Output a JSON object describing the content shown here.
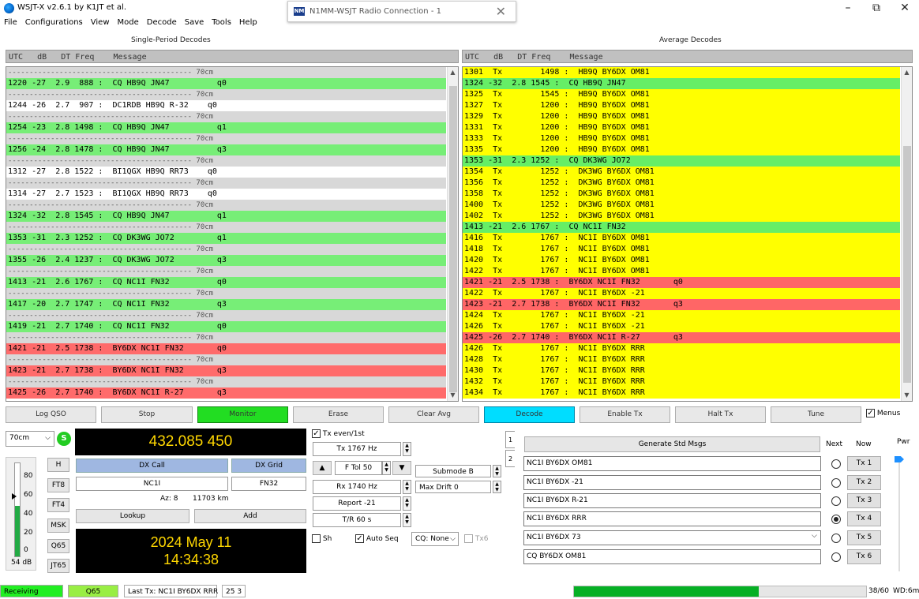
{
  "window": {
    "title": "WSJT-X  v2.6.1  by K1JT et al.",
    "min": "–",
    "max": "⧉",
    "close": "✕"
  },
  "popup": {
    "icon": "NM",
    "title": "N1MM-WSJT Radio Connection - 1",
    "close": "✕"
  },
  "menu": [
    "File",
    "Configurations",
    "View",
    "Mode",
    "Decode",
    "Save",
    "Tools",
    "Help"
  ],
  "left": {
    "title": "Single-Period Decodes",
    "header": "UTC   dB   DT Freq    Message",
    "lines": [
      {
        "c": "sep",
        "t": "------------------------------------------- 70cm"
      },
      {
        "c": "g",
        "t": "1220 -27  2.9  888 :  CQ HB9Q JN47          q0"
      },
      {
        "c": "sep",
        "t": "------------------------------------------- 70cm"
      },
      {
        "c": "w",
        "t": "1244 -26  2.7  907 :  DC1RDB HB9Q R-32    q0"
      },
      {
        "c": "sep",
        "t": "------------------------------------------- 70cm"
      },
      {
        "c": "g",
        "t": "1254 -23  2.8 1498 :  CQ HB9Q JN47          q1"
      },
      {
        "c": "sep",
        "t": "------------------------------------------- 70cm"
      },
      {
        "c": "g",
        "t": "1256 -24  2.8 1478 :  CQ HB9Q JN47          q3"
      },
      {
        "c": "sep",
        "t": "------------------------------------------- 70cm"
      },
      {
        "c": "w",
        "t": "1312 -27  2.8 1522 :  BI1QGX HB9Q RR73    q0"
      },
      {
        "c": "sep",
        "t": "------------------------------------------- 70cm"
      },
      {
        "c": "w",
        "t": "1314 -27  2.7 1523 :  BI1QGX HB9Q RR73    q0"
      },
      {
        "c": "sep",
        "t": "------------------------------------------- 70cm"
      },
      {
        "c": "g",
        "t": "1324 -32  2.8 1545 :  CQ HB9Q JN47          q1"
      },
      {
        "c": "sep",
        "t": "------------------------------------------- 70cm"
      },
      {
        "c": "g",
        "t": "1353 -31  2.3 1252 :  CQ DK3WG JO72         q1"
      },
      {
        "c": "sep",
        "t": "------------------------------------------- 70cm"
      },
      {
        "c": "g",
        "t": "1355 -26  2.4 1237 :  CQ DK3WG JO72         q3"
      },
      {
        "c": "sep",
        "t": "------------------------------------------- 70cm"
      },
      {
        "c": "g",
        "t": "1413 -21  2.6 1767 :  CQ NC1I FN32          q0"
      },
      {
        "c": "sep",
        "t": "------------------------------------------- 70cm"
      },
      {
        "c": "g",
        "t": "1417 -20  2.7 1747 :  CQ NC1I FN32          q3"
      },
      {
        "c": "sep",
        "t": "------------------------------------------- 70cm"
      },
      {
        "c": "g",
        "t": "1419 -21  2.7 1740 :  CQ NC1I FN32          q0"
      },
      {
        "c": "sep",
        "t": "------------------------------------------- 70cm"
      },
      {
        "c": "r",
        "t": "1421 -21  2.5 1738 :  BY6DX NC1I FN32       q0"
      },
      {
        "c": "sep",
        "t": "------------------------------------------- 70cm"
      },
      {
        "c": "r",
        "t": "1423 -21  2.7 1738 :  BY6DX NC1I FN32       q3"
      },
      {
        "c": "sep",
        "t": "------------------------------------------- 70cm"
      },
      {
        "c": "r",
        "t": "1425 -26  2.7 1740 :  BY6DX NC1I R-27       q3"
      }
    ]
  },
  "right": {
    "title": "Average Decodes",
    "header": "UTC   dB   DT Freq    Message",
    "lines": [
      {
        "c": "y",
        "t": "1301  Tx        1498 :  HB9Q BY6DX OM81"
      },
      {
        "c": "yg",
        "t": "1324 -32  2.8 1545 :  CQ HB9Q JN47"
      },
      {
        "c": "y",
        "t": "1325  Tx        1545 :  HB9Q BY6DX OM81"
      },
      {
        "c": "y",
        "t": "1327  Tx        1200 :  HB9Q BY6DX OM81"
      },
      {
        "c": "y",
        "t": "1329  Tx        1200 :  HB9Q BY6DX OM81"
      },
      {
        "c": "y",
        "t": "1331  Tx        1200 :  HB9Q BY6DX OM81"
      },
      {
        "c": "y",
        "t": "1333  Tx        1200 :  HB9Q BY6DX OM81"
      },
      {
        "c": "y",
        "t": "1335  Tx        1200 :  HB9Q BY6DX OM81"
      },
      {
        "c": "yg",
        "t": "1353 -31  2.3 1252 :  CQ DK3WG JO72"
      },
      {
        "c": "y",
        "t": "1354  Tx        1252 :  DK3WG BY6DX OM81"
      },
      {
        "c": "y",
        "t": "1356  Tx        1252 :  DK3WG BY6DX OM81"
      },
      {
        "c": "y",
        "t": "1358  Tx        1252 :  DK3WG BY6DX OM81"
      },
      {
        "c": "y",
        "t": "1400  Tx        1252 :  DK3WG BY6DX OM81"
      },
      {
        "c": "y",
        "t": "1402  Tx        1252 :  DK3WG BY6DX OM81"
      },
      {
        "c": "yg",
        "t": "1413 -21  2.6 1767 :  CQ NC1I FN32"
      },
      {
        "c": "y",
        "t": "1416  Tx        1767 :  NC1I BY6DX OM81"
      },
      {
        "c": "y",
        "t": "1418  Tx        1767 :  NC1I BY6DX OM81"
      },
      {
        "c": "y",
        "t": "1420  Tx        1767 :  NC1I BY6DX OM81"
      },
      {
        "c": "y",
        "t": "1422  Tx        1767 :  NC1I BY6DX OM81"
      },
      {
        "c": "yr",
        "t": "1421 -21  2.5 1738 :  BY6DX NC1I FN32       q0"
      },
      {
        "c": "y",
        "t": "1422  Tx        1767 :  NC1I BY6DX -21"
      },
      {
        "c": "yr",
        "t": "1423 -21  2.7 1738 :  BY6DX NC1I FN32       q3"
      },
      {
        "c": "y",
        "t": "1424  Tx        1767 :  NC1I BY6DX -21"
      },
      {
        "c": "y",
        "t": "1426  Tx        1767 :  NC1I BY6DX -21"
      },
      {
        "c": "yr",
        "t": "1425 -26  2.7 1740 :  BY6DX NC1I R-27       q3"
      },
      {
        "c": "y",
        "t": "1426  Tx        1767 :  NC1I BY6DX RRR"
      },
      {
        "c": "y",
        "t": "1428  Tx        1767 :  NC1I BY6DX RRR"
      },
      {
        "c": "y",
        "t": "1430  Tx        1767 :  NC1I BY6DX RRR"
      },
      {
        "c": "y",
        "t": "1432  Tx        1767 :  NC1I BY6DX RRR"
      },
      {
        "c": "y",
        "t": "1434  Tx        1767 :  NC1I BY6DX RRR"
      }
    ]
  },
  "buttons": {
    "log_qso": "Log QSO",
    "stop": "Stop",
    "monitor": "Monitor",
    "erase": "Erase",
    "clear_avg": "Clear Avg",
    "decode": "Decode",
    "enable_tx": "Enable Tx",
    "halt_tx": "Halt Tx",
    "tune": "Tune",
    "menus": "Menus"
  },
  "band": {
    "value": "70cm",
    "s": "S"
  },
  "frequency": "432.085 450",
  "modes": [
    "H",
    "FT8",
    "FT4",
    "MSK",
    "Q65",
    "JT65"
  ],
  "meter": {
    "labels": [
      "80",
      "60",
      "40",
      "20",
      "0"
    ],
    "db": "54 dB",
    "level": 0.54
  },
  "dx": {
    "call_label": "DX Call",
    "grid_label": "DX Grid",
    "call": "NC1I",
    "grid": "FN32",
    "az": "Az: 8",
    "dist": "11703 km",
    "lookup": "Lookup",
    "add": "Add"
  },
  "clock": {
    "date": "2024 May 11",
    "time": "14:34:38"
  },
  "ctrl": {
    "tx_even": "Tx even/1st",
    "tx_freq": "Tx  1767 Hz",
    "ftol": "F Tol  50",
    "rx_freq": "Rx  1740 Hz",
    "report": "Report -21",
    "tr": "T/R  60 s",
    "sh": "Sh",
    "auto_seq": "Auto Seq",
    "cq": "CQ: None",
    "tx6": "Tx6",
    "submode": "Submode B",
    "max_drift": "Max Drift  0",
    "up": "▲",
    "down": "▼"
  },
  "tabs": [
    "1",
    "2"
  ],
  "std": {
    "generate": "Generate Std Msgs",
    "next": "Next",
    "now": "Now",
    "pwr": "Pwr",
    "msgs": [
      "NC1I BY6DX OM81",
      "NC1I BY6DX -21",
      "NC1I BY6DX R-21",
      "NC1I BY6DX RRR",
      "NC1I BY6DX 73",
      "CQ BY6DX OM81"
    ],
    "tx": [
      "Tx 1",
      "Tx 2",
      "Tx 3",
      "Tx 4",
      "Tx 5",
      "Tx 6"
    ],
    "selected": 3
  },
  "status": {
    "receiving": "Receiving",
    "mode": "Q65",
    "last_tx": "Last Tx: NC1I BY6DX RRR",
    "num": "25  3",
    "progress_text": "38/60",
    "wd": "WD:6m",
    "progress": 0.633
  }
}
